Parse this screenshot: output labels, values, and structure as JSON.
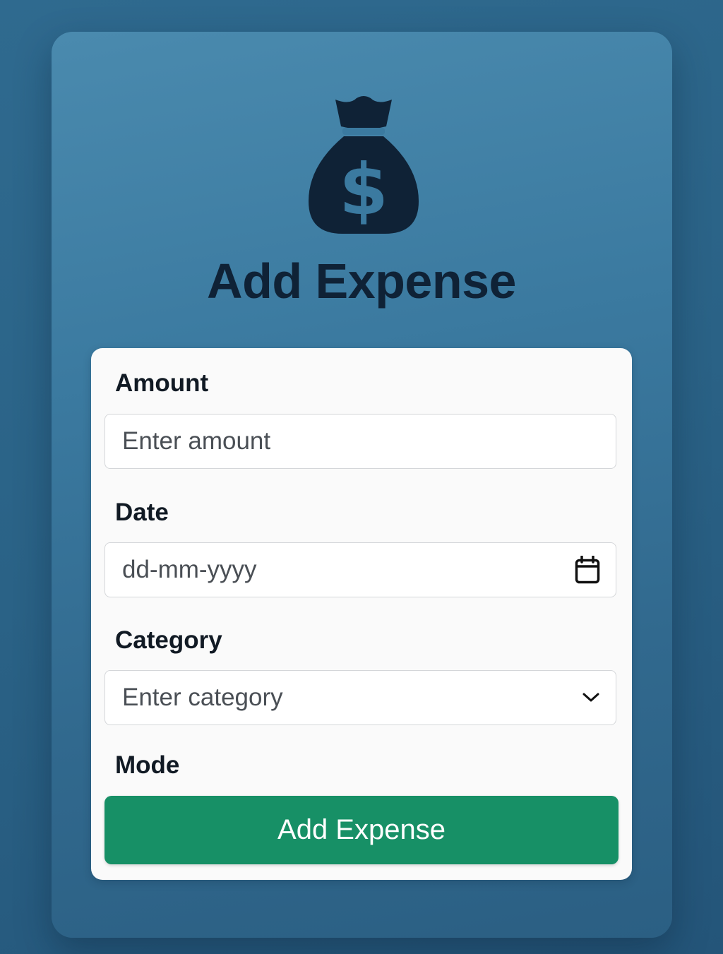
{
  "header": {
    "icon": "money-bag-icon",
    "title": "Add Expense"
  },
  "form": {
    "amount": {
      "label": "Amount",
      "placeholder": "Enter amount",
      "value": ""
    },
    "date": {
      "label": "Date",
      "placeholder": "dd-mm-yyyy",
      "value": "",
      "icon": "calendar-icon"
    },
    "category": {
      "label": "Category",
      "placeholder": "Enter category",
      "value": "",
      "icon": "chevron-down-icon"
    },
    "mode": {
      "label": "Mode"
    },
    "submit_label": "Add Expense"
  },
  "colors": {
    "background": "#2a6286",
    "card": "#3b7aa0",
    "title": "#0f2236",
    "panel": "#fafafa",
    "button": "#179066"
  }
}
